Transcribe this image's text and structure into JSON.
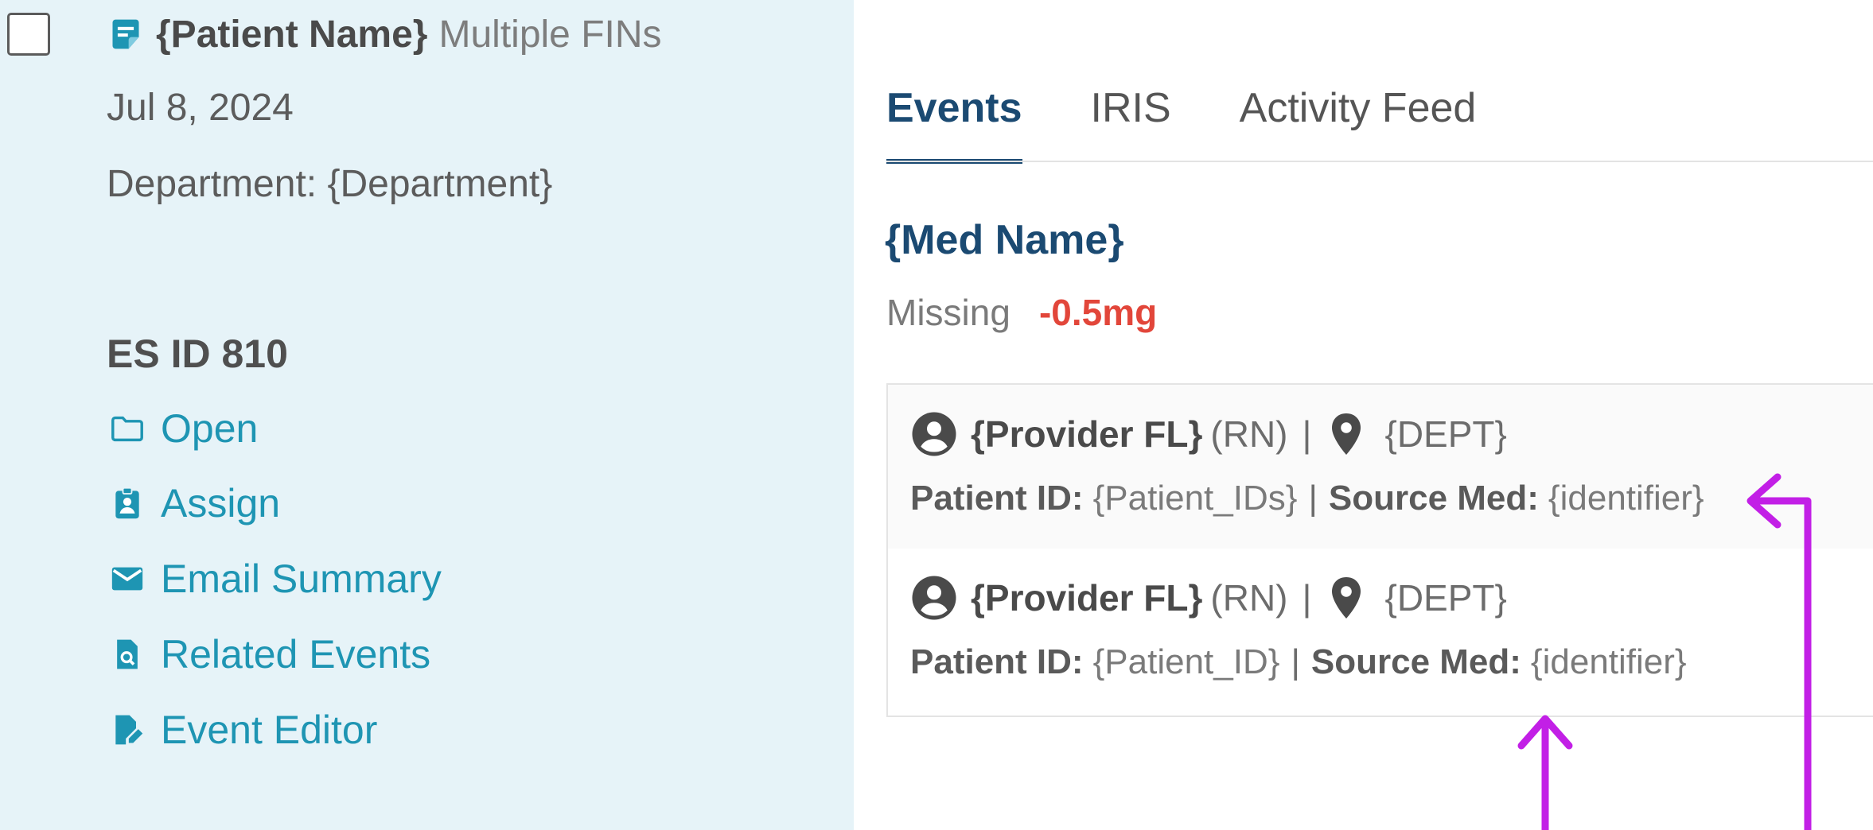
{
  "left_panel": {
    "patient": {
      "name": "{Patient Name}",
      "subtitle": "Multiple FINs"
    },
    "date": "Jul 8, 2024",
    "department": "Department: {Department}",
    "es_id": "ES ID 810",
    "actions": [
      {
        "label": "Open",
        "icon": "folder-icon"
      },
      {
        "label": "Assign",
        "icon": "clipboard-person-icon"
      },
      {
        "label": "Email Summary",
        "icon": "envelope-icon"
      },
      {
        "label": "Related Events",
        "icon": "document-search-icon"
      },
      {
        "label": "Event Editor",
        "icon": "document-edit-icon"
      }
    ]
  },
  "tabs": [
    {
      "label": "Events",
      "active": true
    },
    {
      "label": "IRIS",
      "active": false
    },
    {
      "label": "Activity Feed",
      "active": false
    }
  ],
  "event": {
    "med_name": "{Med Name}",
    "missing_label": "Missing",
    "missing_value": "-0.5mg"
  },
  "records": [
    {
      "provider": "{Provider FL}",
      "role": "(RN)",
      "separator": "|",
      "dept": "{DEPT}",
      "patient_id_label": "Patient ID:",
      "patient_id_value": "{Patient_IDs}",
      "pipe": "|",
      "source_med_label": "Source Med:",
      "source_med_value": "{identifier}"
    },
    {
      "provider": "{Provider FL}",
      "role": "(RN)",
      "separator": "|",
      "dept": "{DEPT}",
      "patient_id_label": "Patient ID:",
      "patient_id_value": "{Patient_ID}",
      "pipe": "|",
      "source_med_label": "Source Med:",
      "source_med_value": "{identifier}"
    }
  ],
  "colors": {
    "panel_bg": "#e6f3f8",
    "action_link": "#1e95b3",
    "tab_active": "#1b4a72",
    "negative": "#e2463a",
    "annotation": "#c21fe6"
  }
}
